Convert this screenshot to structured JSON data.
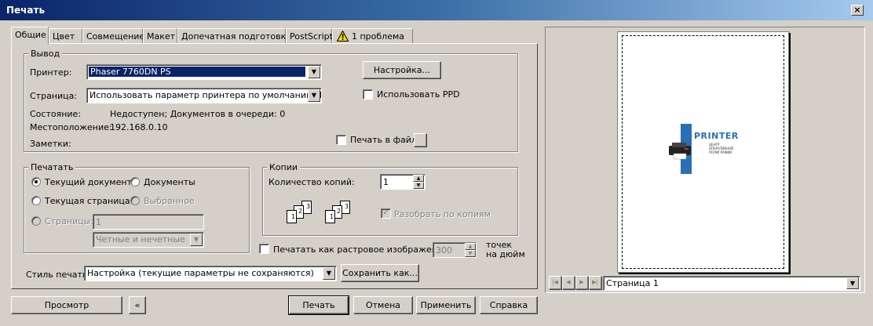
{
  "window": {
    "title": "Печать",
    "close_icon": "×"
  },
  "tabs": [
    {
      "label": "Общие",
      "active": true
    },
    {
      "label": "Цвет"
    },
    {
      "label": "Совмещение"
    },
    {
      "label": "Макет"
    },
    {
      "label": "Допечатная подготовка"
    },
    {
      "label": "PostScript"
    },
    {
      "label": "1 проблема",
      "icon": "warning-icon"
    }
  ],
  "output": {
    "group_title": "Вывод",
    "printer_label": "Принтер:",
    "printer_value": "Phaser 7760DN PS",
    "page_label": "Страница:",
    "page_value": "Использовать параметр принтера по умолчанию (К…",
    "status_label": "Состояние:",
    "status_value": "Недоступен; Документов в очереди: 0",
    "location_label": "Местоположение:",
    "location_value": "192.168.0.10",
    "notes_label": "Заметки:",
    "settings_button": "Настройка...",
    "use_ppd_label": "Использовать PPD",
    "print_to_file_label": "Печать в файл"
  },
  "print_range": {
    "group_title": "Печатать",
    "current_document": "Текущий документ",
    "documents": "Документы",
    "current_page": "Текущая страница",
    "selection": "Выбранное",
    "pages_label": "Страницы:",
    "pages_value": "1",
    "parity_value": "Четные и нечетные"
  },
  "copies": {
    "group_title": "Копии",
    "count_label": "Количество копий:",
    "count_value": "1",
    "collate_label": "Разобрать по копиям",
    "collate_checked": true,
    "collate_icon_labels": [
      "1",
      "2",
      "3"
    ]
  },
  "raster": {
    "label": "Печатать как растровое изображение:",
    "dpi_value": "300",
    "dpi_unit": "точек на дюйм"
  },
  "print_style": {
    "label": "Стиль печати:",
    "value": "Настройка (текущие параметры не сохраняются)",
    "save_button": "Сохранить как..."
  },
  "preview": {
    "page_select": "Страница 1",
    "logo_title": "PRINTER",
    "logo_subtitle": "ЦЕНТР ОПЕРАТИВНОЙ ПОЛИГРАФИИ"
  },
  "footer": {
    "preview_button": "Просмотр",
    "collapse_icon": "«",
    "print_button": "Печать",
    "cancel_button": "Отмена",
    "apply_button": "Применить",
    "help_button": "Справка"
  },
  "colors": {
    "title_start": "#0a246a",
    "title_end": "#a6caf0",
    "face": "#d4d0c8",
    "selection": "#0a246a",
    "logo_blue": "#2a6fb5"
  }
}
